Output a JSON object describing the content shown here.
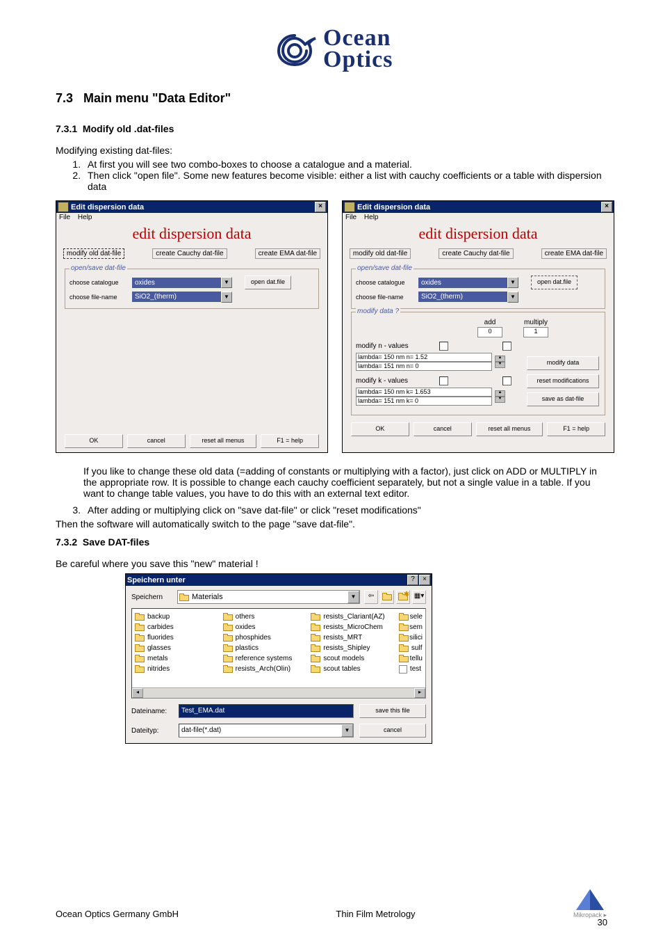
{
  "logo": {
    "top": "Ocean",
    "bottom": "Optics"
  },
  "section": {
    "num": "7.3",
    "title": "Main menu \"Data Editor\""
  },
  "sub1": {
    "num": "7.3.1",
    "title": "Modify old .dat-files"
  },
  "para1": "Modifying existing dat-files:",
  "step1": "At first you will see two combo-boxes to choose a catalogue and a material.",
  "step2": "Then click \"open file\". Some new features become visible: either a list with cauchy coefficients or a table with dispersion data",
  "win": {
    "title": "Edit dispersion data",
    "menu": {
      "file": "File",
      "help": "Help"
    },
    "bigtitle": "edit dispersion data",
    "tabs": {
      "modify": "modify old dat-file",
      "cauchy": "create Cauchy dat-file",
      "ema": "create EMA dat-file"
    },
    "group_open": "open/save dat-file",
    "lbl_cat": "choose catalogue",
    "lbl_file": "choose file-name",
    "val_cat": "oxides",
    "val_file": "SiO2_(therm)",
    "btn_open": "open dat.file",
    "group_mod": "modify data ?",
    "col_add": "add",
    "col_mul": "multiply",
    "val_add": "0",
    "val_mul": "1",
    "lbl_n": "modify n - values",
    "n_rows": [
      "lambda= 150 nm      n= 1.52",
      "lambda= 151 nm      n= 0"
    ],
    "lbl_k": "modify k - values",
    "k_rows": [
      "lambda= 150 nm      k= 1.653",
      "lambda= 151 nm      k= 0"
    ],
    "btn_moddata": "modify data",
    "btn_reset": "reset modifications",
    "btn_saveas": "save as dat-file",
    "bottom": {
      "ok": "OK",
      "cancel": "cancel",
      "resetall": "reset all menus",
      "help": "F1 = help"
    }
  },
  "indent_para": "If you like to change these old data (=adding of constants or multiplying with a factor), just click on ADD or MULTIPLY in the appropriate row. It is possible to change each cauchy coefficient separately, but not a single value in a table. If you want to change table values, you have to do this with an external text editor.",
  "step3": "After adding or multiplying click on \"save dat-file\" or click \"reset modifications\"",
  "after_steps": "Then the software will automatically switch to the page \"save dat-file\".",
  "sub2": {
    "num": "7.3.2",
    "title": "Save DAT-files"
  },
  "para2": "Be careful where you save this \"new\" material !",
  "savedlg": {
    "title": "Speichern unter",
    "lbl_savein": "Speichern",
    "val_savein": "Materials",
    "cols": [
      [
        "backup",
        "carbides",
        "fluorides",
        "glasses",
        "metals",
        "nitrides"
      ],
      [
        "others",
        "oxides",
        "phosphides",
        "plastics",
        "reference systems",
        "resists_Arch(Olin)"
      ],
      [
        "resists_Clariant(AZ)",
        "resists_MicroChem",
        "resists_MRT",
        "resists_Shipley",
        "scout models",
        "scout tables"
      ],
      [
        "sele",
        "sem",
        "silici",
        "sulf",
        "tellu",
        "test"
      ]
    ],
    "last_is_file_idx": 5,
    "lbl_name": "Dateiname:",
    "val_name": "Test_EMA.dat",
    "lbl_type": "Dateityp:",
    "val_type": "dat-file(*.dat)",
    "btn_save": "save this file",
    "btn_cancel": "cancel"
  },
  "footer": {
    "left": "Ocean Optics Germany GmbH",
    "right": "Thin Film Metrology",
    "logo": "Mikropack",
    "page": "30"
  }
}
